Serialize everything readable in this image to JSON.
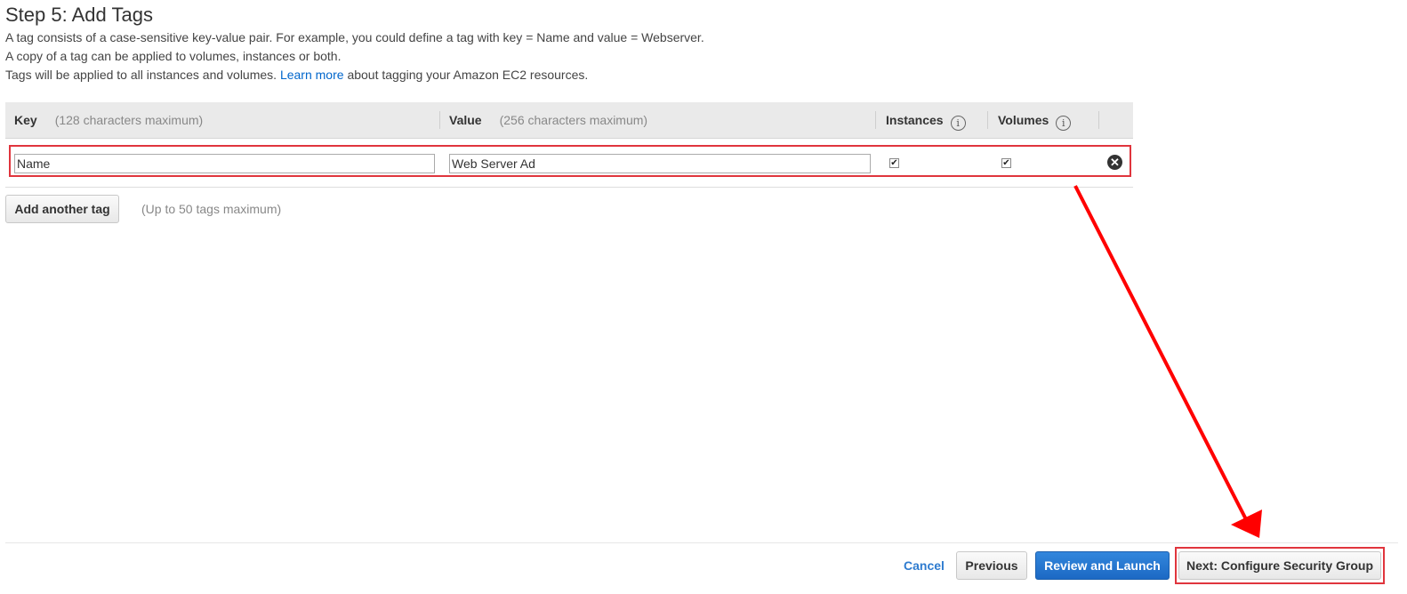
{
  "page": {
    "title": "Step 5: Add Tags",
    "desc_line1": "A tag consists of a case-sensitive key-value pair. For example, you could define a tag with key = Name and value = Webserver.",
    "desc_line2": "A copy of a tag can be applied to volumes, instances or both.",
    "desc_line3_pre": "Tags will be applied to all instances and volumes.",
    "learn_more": "Learn more",
    "desc_line3_post": "about tagging your Amazon EC2 resources."
  },
  "table": {
    "headers": {
      "key": "Key",
      "key_hint": "(128 characters maximum)",
      "value": "Value",
      "value_hint": "(256 characters maximum)",
      "instances": "Instances",
      "volumes": "Volumes",
      "info_glyph": "i"
    },
    "rows": [
      {
        "key": "Name",
        "value": "Web Server Ad",
        "instances": true,
        "volumes": true
      }
    ],
    "remove_glyph": "✕"
  },
  "add_tag": {
    "button_label": "Add another tag",
    "hint": "(Up to 50 tags maximum)"
  },
  "footer": {
    "cancel": "Cancel",
    "previous": "Previous",
    "review_launch": "Review and Launch",
    "next": "Next: Configure Security Group"
  },
  "colors": {
    "highlight": "#e0353d",
    "primary_button": "#1c69c4",
    "link": "#0066cc",
    "arrow": "#ff0000"
  }
}
